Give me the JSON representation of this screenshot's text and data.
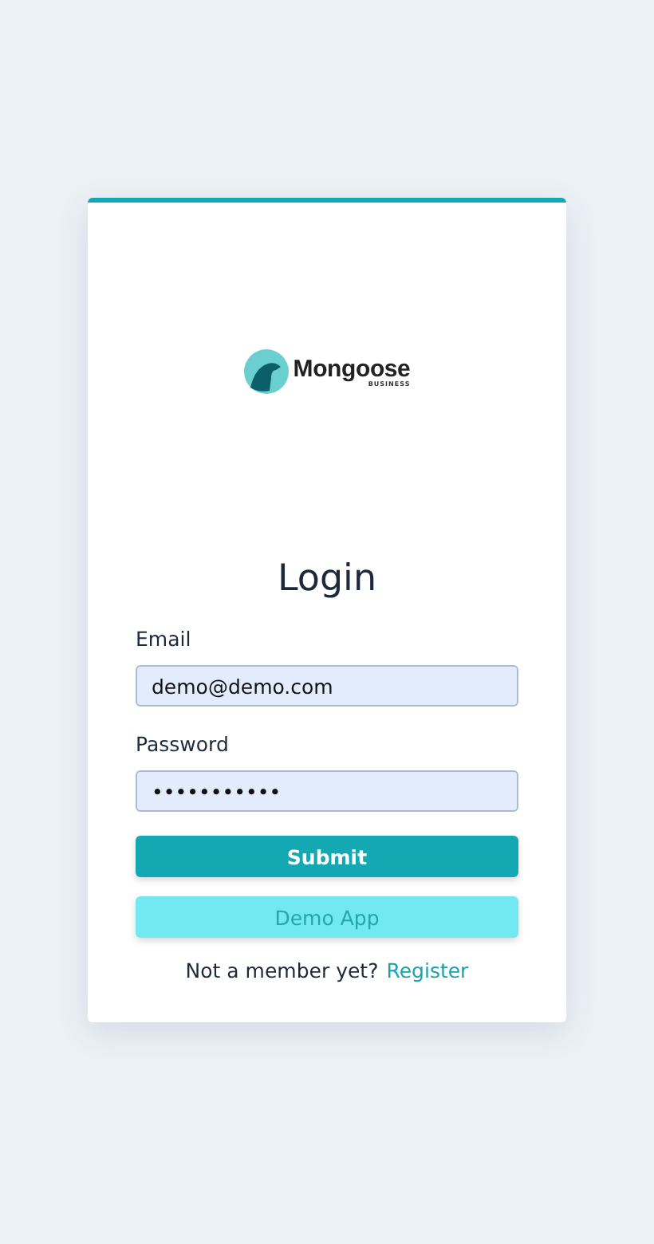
{
  "logo": {
    "name": "Mongoose",
    "tagline": "BUSINESS"
  },
  "title": "Login",
  "fields": [
    {
      "label": "Email",
      "value": "demo@demo.com"
    },
    {
      "label": "Password",
      "value": "•••••••••••"
    }
  ],
  "buttons": [
    {
      "label": "Submit",
      "kind": "primary"
    },
    {
      "label": "Demo App",
      "kind": "secondary"
    }
  ],
  "footer": {
    "text": "Not a member yet?",
    "link": "Register"
  }
}
